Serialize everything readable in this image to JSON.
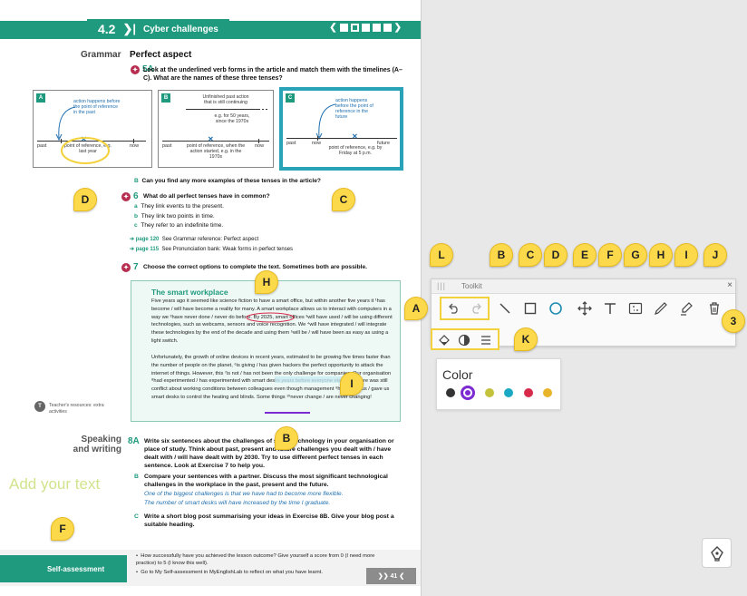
{
  "header": {
    "unit": "4.2",
    "title": "Cyber challenges"
  },
  "grammar": {
    "heading": "Grammar",
    "topic": "Perfect aspect"
  },
  "ex5a": {
    "num": "5A",
    "text": "Look at the underlined verb forms in the article and match them with the timelines (A–C). What are the names of these three tenses?"
  },
  "timelines": {
    "a": {
      "label": "A",
      "top_note": "action happens before the point of reference in the past",
      "left": "past",
      "right": "now",
      "bottom_note": "point of reference, e.g. last year"
    },
    "b": {
      "label": "B",
      "top_note": "Unfinished past action that is still continuing",
      "mid_note": "e.g. for 50 years, since the 1970s",
      "left": "past",
      "right": "now",
      "bottom_note": "point of reference, when the action started, e.g. in the 1970s"
    },
    "c": {
      "label": "C",
      "top_note": "action happens before the point of reference in the future",
      "left": "past",
      "mid": "now",
      "right": "future",
      "bottom_note": "point of reference, e.g. by Friday at 5 p.m."
    }
  },
  "ex5b": {
    "label": "B",
    "text": "Can you find any more examples of these tenses in the article?"
  },
  "ex6": {
    "num": "6",
    "text": "What do all perfect tenses have in common?",
    "a_label": "a",
    "a": "They link events to the present.",
    "b_label": "b",
    "b": "They link two points in time.",
    "c_label": "c",
    "c": "They refer to an indefinite time.",
    "link1_page": "page 120",
    "link1": "See Grammar reference: Perfect aspect",
    "link2_page": "page 115",
    "link2": "See Pronunciation bank: Weak forms in perfect tenses"
  },
  "ex7": {
    "num": "7",
    "text": "Choose the correct options to complete the text. Sometimes both are possible."
  },
  "article": {
    "title": "The smart workplace",
    "p1": "Five years ago it seemed like science fiction to have a smart office, but within another five years it ¹has become / will have become a reality for many. A smart workplace allows us to interact with computers in a way we ²have never done / never do before. By 2025, smart offices ³will have used / will be using different technologies, such as webcams, sensors and voice recognition. We ⁴will have integrated / will integrate these technologies by the end of the decade and using them ⁵will be / will have been as easy as using a light switch.",
    "p2": "Unfortunately, the growth of online devices in recent years, estimated to be growing five times faster than the number of people on the planet, ⁶is giving / has given hackers the perfect opportunity to attack the internet of things. However, this ⁷is not / has not been the only challenge for companies. Our organisation ⁸had experimented / has experimented with smart desks years before everyone else did. There was still conflict about working conditions between colleagues even though management ⁹had given us / gave us smart desks to control the heating and blinds. Some things ¹⁰never change / are never changing!"
  },
  "teacher": {
    "icon": "T",
    "text": "Teacher's resources: extra activities"
  },
  "speaking": {
    "heading_1": "Speaking",
    "heading_2": "and writing",
    "q8a_num": "8A",
    "q8a": "Write six sentences about the challenges of smart technology in your organisation or place of study. Think about past, present and future challenges you dealt with / have dealt with / will have dealt with by 2030. Try to use different perfect tenses in each sentence. Look at Exercise 7 to help you.",
    "q8b_label": "B",
    "q8b": "Compare your sentences with a partner. Discuss the most significant technological challenges in the workplace in the past, present and the future.",
    "ex1": "One of the biggest challenges is that we have had to become more flexible.",
    "ex2": "The number of smart desks will have increased by the time I graduate.",
    "q8c_label": "C",
    "q8c": "Write a short blog post summarising your ideas in Exercise 8B. Give your blog post a suitable heading."
  },
  "add_text": "Add your text",
  "self_assessment": {
    "label": "Self-assessment",
    "item1": "How successfully have you achieved the lesson outcome? Give yourself a score from 0 (I need more practice) to 5 (I know this well).",
    "item2": "Go to My Self-assessment in MyEnglishLab to reflect on what you have learnt.",
    "page": "41"
  },
  "markers": {
    "d_page": "D",
    "c_page": "C",
    "h_page": "H",
    "i_page": "I",
    "b_page": "B",
    "f_page": "F",
    "l": "L",
    "b": "B",
    "c": "C",
    "d": "D",
    "e": "E",
    "f": "F",
    "g": "G",
    "h": "H",
    "i": "I",
    "j": "J",
    "a": "A",
    "k": "K",
    "three": "3"
  },
  "toolkit": {
    "title": "Toolkit",
    "close": "×"
  },
  "color_panel": {
    "title": "Color",
    "swatches": [
      "#333333",
      "#7b2bd1",
      "#c3c23a",
      "#19a9c4",
      "#d82a4a",
      "#e8b52a"
    ],
    "selected": "#7b2bd1"
  },
  "icons": {
    "undo": "undo-icon",
    "redo": "redo-icon",
    "line": "line-icon",
    "rectangle": "rectangle-icon",
    "circle": "circle-icon",
    "move": "move-icon",
    "text": "text-icon",
    "eraser": "eraser-icon",
    "pen": "pen-icon",
    "highlighter": "highlighter-icon",
    "delete": "trash-icon",
    "fill": "fill-icon",
    "opacity": "opacity-icon",
    "stroke": "stroke-width-icon",
    "pen_toggle": "pen-toggle-icon"
  }
}
